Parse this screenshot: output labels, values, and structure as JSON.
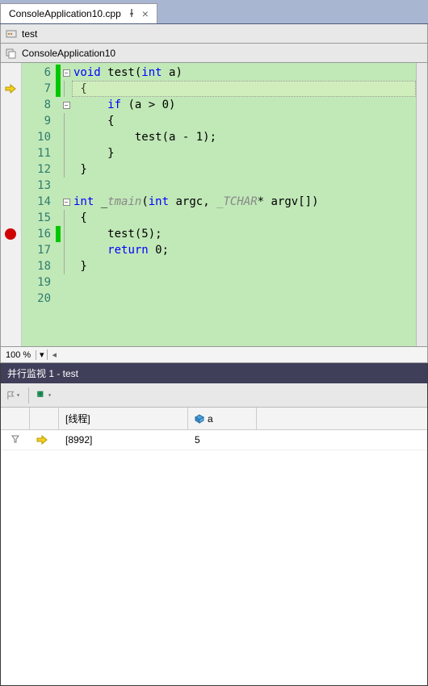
{
  "tab": {
    "filename": "ConsoleApplication10.cpp"
  },
  "nav1": {
    "text": "test"
  },
  "nav2": {
    "text": "ConsoleApplication10"
  },
  "editor": {
    "line_start": 6,
    "lines": [
      {
        "n": 6,
        "change": true,
        "fold": "minus",
        "html": "<span class='kw'>void</span> test(<span class='kw'>int</span> a)"
      },
      {
        "n": 7,
        "change": true,
        "fold": "line",
        "html": " {",
        "current": true
      },
      {
        "n": 8,
        "change": false,
        "fold": "minus",
        "html": "     <span class='kw'>if</span> (a &gt; 0)"
      },
      {
        "n": 9,
        "change": false,
        "fold": "line",
        "html": "     {"
      },
      {
        "n": 10,
        "change": false,
        "fold": "line",
        "html": "         test(a - 1);"
      },
      {
        "n": 11,
        "change": false,
        "fold": "line",
        "html": "     }"
      },
      {
        "n": 12,
        "change": false,
        "fold": "line",
        "html": " }"
      },
      {
        "n": 13,
        "change": false,
        "fold": "",
        "html": ""
      },
      {
        "n": 14,
        "change": false,
        "fold": "minus",
        "html": "<span class='kw'>int</span> _<span class='ital'>tmain</span>(<span class='kw'>int</span> argc, <span class='ital'>_TCHAR</span>* argv[])"
      },
      {
        "n": 15,
        "change": false,
        "fold": "line",
        "html": " {"
      },
      {
        "n": 16,
        "change": true,
        "fold": "line",
        "html": "     test(5);",
        "breakpoint": true
      },
      {
        "n": 17,
        "change": false,
        "fold": "line",
        "html": "     <span class='kw'>return</span> 0;"
      },
      {
        "n": 18,
        "change": false,
        "fold": "line",
        "html": " }"
      },
      {
        "n": 19,
        "change": false,
        "fold": "",
        "html": ""
      },
      {
        "n": 20,
        "change": false,
        "fold": "",
        "html": ""
      }
    ],
    "exec_arrow_line": 7
  },
  "zoom": {
    "value": "100 %"
  },
  "watch": {
    "title": "并行监视 1 - test",
    "columns": {
      "thread": "[线程]",
      "var": "a"
    },
    "rows": [
      {
        "thread": "[8992]",
        "value": "5",
        "has_funnel": true,
        "has_arrow": true
      }
    ]
  }
}
